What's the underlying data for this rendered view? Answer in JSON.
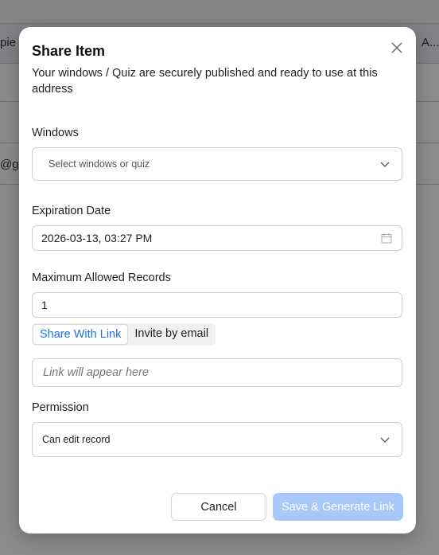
{
  "background": {
    "row2_left_text": "pie",
    "row2_right_text": "A...",
    "row4_left_text": "@gre"
  },
  "modal": {
    "title": "Share Item",
    "description": "Your windows / Quiz are securely published and ready to use at this address",
    "close_icon": "close-icon"
  },
  "windows": {
    "label": "Windows",
    "placeholder": "Select windows or quiz"
  },
  "expiration": {
    "label": "Expiration Date",
    "value": "2026-03-13, 03:27 PM"
  },
  "records": {
    "label": "Maximum Allowed Records",
    "value": "1"
  },
  "tabs": [
    {
      "label": "Share With Link",
      "active": true
    },
    {
      "label": "Invite by email",
      "active": false
    }
  ],
  "link": {
    "placeholder": "Link will appear here"
  },
  "permission": {
    "label": "Permission",
    "value": "Can edit record"
  },
  "buttons": {
    "cancel_label": "Cancel",
    "save_label": "Save & Generate Link"
  },
  "colors": {
    "accent": "#1a73e8",
    "save_disabled": "#a6c8fa",
    "overlay": "rgba(0,0,0,0.45)"
  }
}
